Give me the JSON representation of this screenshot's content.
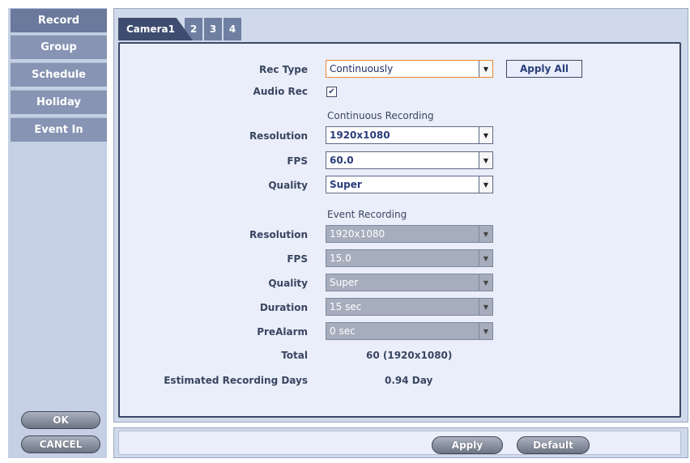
{
  "sidebar": {
    "items": [
      {
        "label": "Record",
        "active": true
      },
      {
        "label": "Group"
      },
      {
        "label": "Schedule"
      },
      {
        "label": "Holiday"
      },
      {
        "label": "Event In"
      }
    ],
    "ok_label": "OK",
    "cancel_label": "CANCEL"
  },
  "tabs": [
    {
      "label": "Camera1",
      "active": true
    },
    {
      "label": "2"
    },
    {
      "label": "3"
    },
    {
      "label": "4"
    }
  ],
  "form": {
    "rec_type_label": "Rec Type",
    "rec_type_value": "Continuously",
    "apply_all_label": "Apply All",
    "audio_rec_label": "Audio Rec",
    "audio_rec_checked": true,
    "checkmark": "✔",
    "continuous_section": "Continuous Recording",
    "continuous": {
      "resolution_label": "Resolution",
      "resolution_value": "1920x1080",
      "fps_label": "FPS",
      "fps_value": "60.0",
      "quality_label": "Quality",
      "quality_value": "Super"
    },
    "event_section": "Event Recording",
    "event": {
      "resolution_label": "Resolution",
      "resolution_value": "1920x1080",
      "fps_label": "FPS",
      "fps_value": "15.0",
      "quality_label": "Quality",
      "quality_value": "Super",
      "duration_label": "Duration",
      "duration_value": "15 sec",
      "prealarm_label": "PreAlarm",
      "prealarm_value": "0 sec"
    },
    "total_label": "Total",
    "total_value": "60 (1920x1080)",
    "est_days_label": "Estimated Recording Days",
    "est_days_value": "0.94 Day"
  },
  "footer": {
    "apply_label": "Apply",
    "default_label": "Default"
  },
  "icons": {
    "dropdown_arrow": "▼"
  },
  "colors": {
    "panel_bg": "#e9eefa",
    "frame_bg": "#cfd9ea",
    "sidebar_item": "#8794b3",
    "active_tab": "#3e4c70",
    "focus_border": "#e8862c"
  }
}
